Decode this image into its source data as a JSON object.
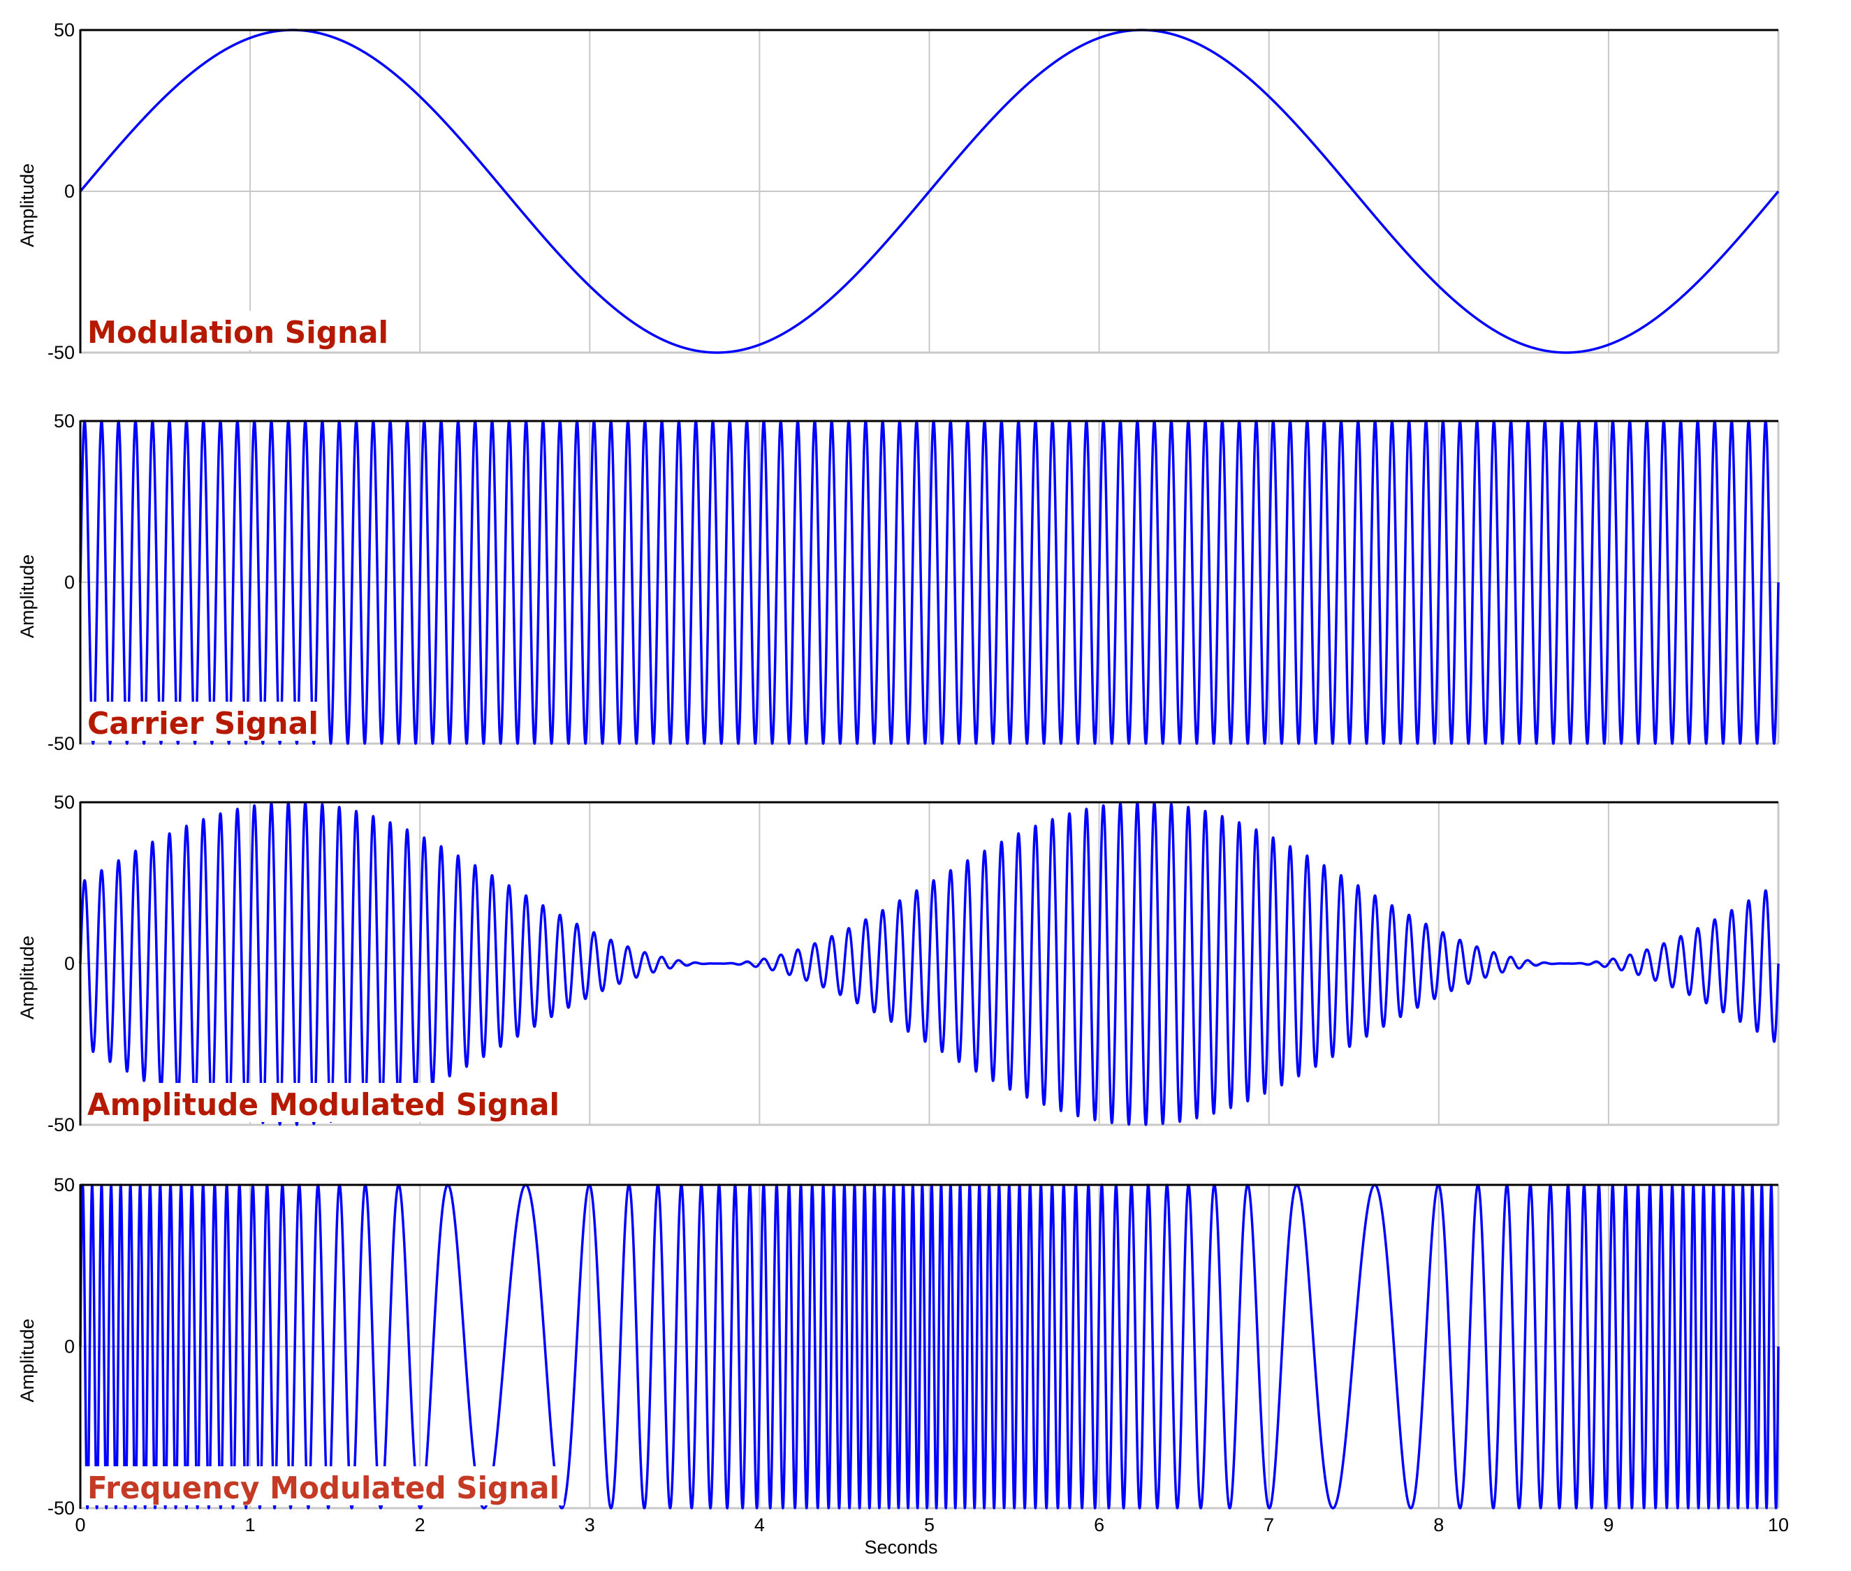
{
  "chart_data": [
    {
      "type": "line",
      "title": "Modulation Signal",
      "title_color": "#b51a00",
      "xlabel": "",
      "ylabel": "Amplitude",
      "xlim": [
        0,
        10
      ],
      "ylim": [
        -50,
        50
      ],
      "yticks": [
        "50",
        "0",
        "-50"
      ],
      "grid": true,
      "series": [
        {
          "name": "Modulation Signal",
          "color": "#0000ff",
          "formula": "m(t) = 50*sin(2*pi*0.2*t)",
          "amplitude": 50,
          "frequency_hz": 0.2
        }
      ]
    },
    {
      "type": "line",
      "title": "Carrier Signal",
      "title_color": "#b51a00",
      "xlabel": "",
      "ylabel": "Amplitude",
      "xlim": [
        0,
        10
      ],
      "ylim": [
        -50,
        50
      ],
      "yticks": [
        "50",
        "0",
        "-50"
      ],
      "grid": true,
      "series": [
        {
          "name": "Carrier Signal",
          "color": "#0000ff",
          "formula": "c(t) = 50*sin(2*pi*10*t)",
          "amplitude": 50,
          "frequency_hz": 10
        }
      ]
    },
    {
      "type": "line",
      "title": "Amplitude Modulated Signal",
      "title_color": "#b51a00",
      "xlabel": "",
      "ylabel": "Amplitude",
      "xlim": [
        0,
        10
      ],
      "ylim": [
        -50,
        50
      ],
      "yticks": [
        "50",
        "0",
        "-50"
      ],
      "grid": true,
      "series": [
        {
          "name": "Amplitude Modulated Signal",
          "color": "#0000ff",
          "formula": "am(t) = ((m(t)+50)/2)*sin(2*pi*10*t)",
          "envelope_offset": 50,
          "envelope_scale": 0.5,
          "carrier_frequency_hz": 10
        }
      ]
    },
    {
      "type": "line",
      "title": "Frequency Modulated Signal",
      "title_color": "#c43a24",
      "xlabel": "Seconds",
      "ylabel": "Amplitude",
      "xlim": [
        0,
        10
      ],
      "ylim": [
        -50,
        50
      ],
      "yticks": [
        "50",
        "0",
        "-50"
      ],
      "xticks": [
        "0",
        "1",
        "2",
        "3",
        "4",
        "5",
        "6",
        "7",
        "8",
        "9",
        "10"
      ],
      "grid": true,
      "series": [
        {
          "name": "Frequency Modulated Signal",
          "color": "#0000ff",
          "formula": "fm(t) = 50*sin(2*pi*10*t + 40*sin(2*pi*0.2*t))",
          "amplitude": 50,
          "carrier_frequency_hz": 10,
          "frequency_deviation_hz": 8,
          "modulation_frequency_hz": 0.2
        }
      ]
    }
  ]
}
